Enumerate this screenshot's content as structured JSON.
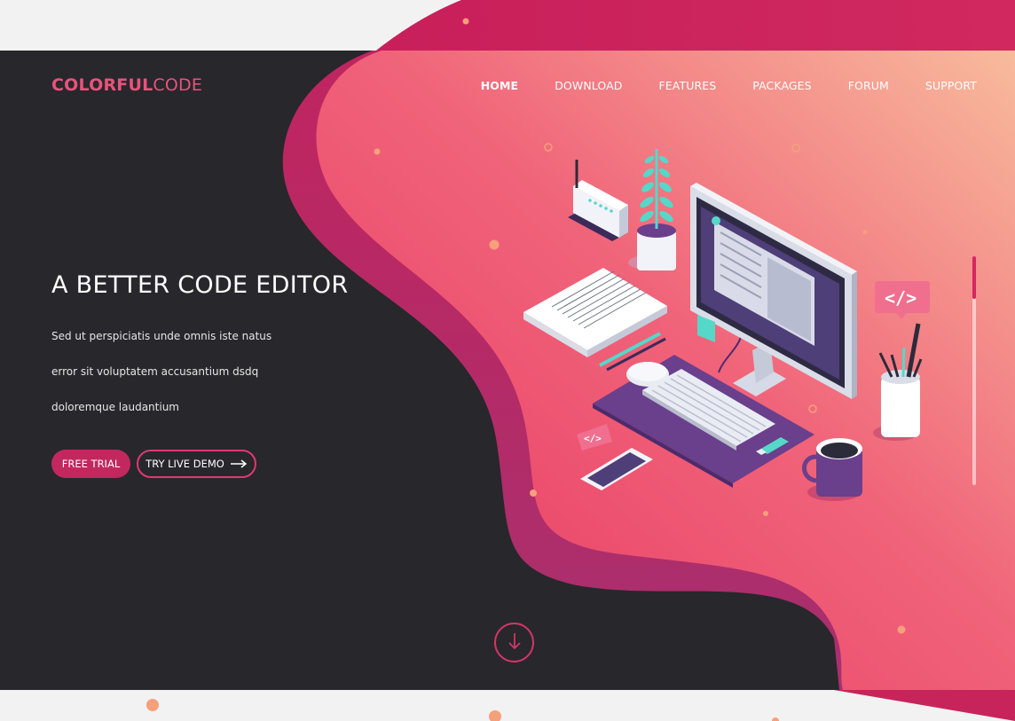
{
  "brand": {
    "bold": "COLORFUL",
    "thin": "CODE"
  },
  "nav": {
    "items": [
      {
        "label": "HOME",
        "active": true
      },
      {
        "label": "DOWNLOAD",
        "active": false
      },
      {
        "label": "FEATURES",
        "active": false
      },
      {
        "label": "PACKAGES",
        "active": false
      },
      {
        "label": "FORUM",
        "active": false
      },
      {
        "label": "SUPPORT",
        "active": false
      }
    ]
  },
  "hero": {
    "title": "A BETTER CODE EDITOR",
    "lines": [
      "Sed ut perspiciatis unde omnis iste natus",
      "error sit voluptatem accusantium  dsdq",
      "doloremque laudantium"
    ],
    "primary_button": "FREE TRIAL",
    "secondary_button": "TRY LIVE DEMO"
  },
  "illustration": {
    "code_badge_large": "</>",
    "code_badge_small": "</>"
  },
  "icons": {
    "scroll_down": "arrow-down-icon",
    "demo_arrow": "arrow-right-icon"
  },
  "colors": {
    "brand_pink": "#e8537b",
    "accent_magenta": "#c2285e",
    "dark_bg": "#28272c",
    "gradient_start": "#ea4665",
    "gradient_end": "#f7b59a"
  }
}
